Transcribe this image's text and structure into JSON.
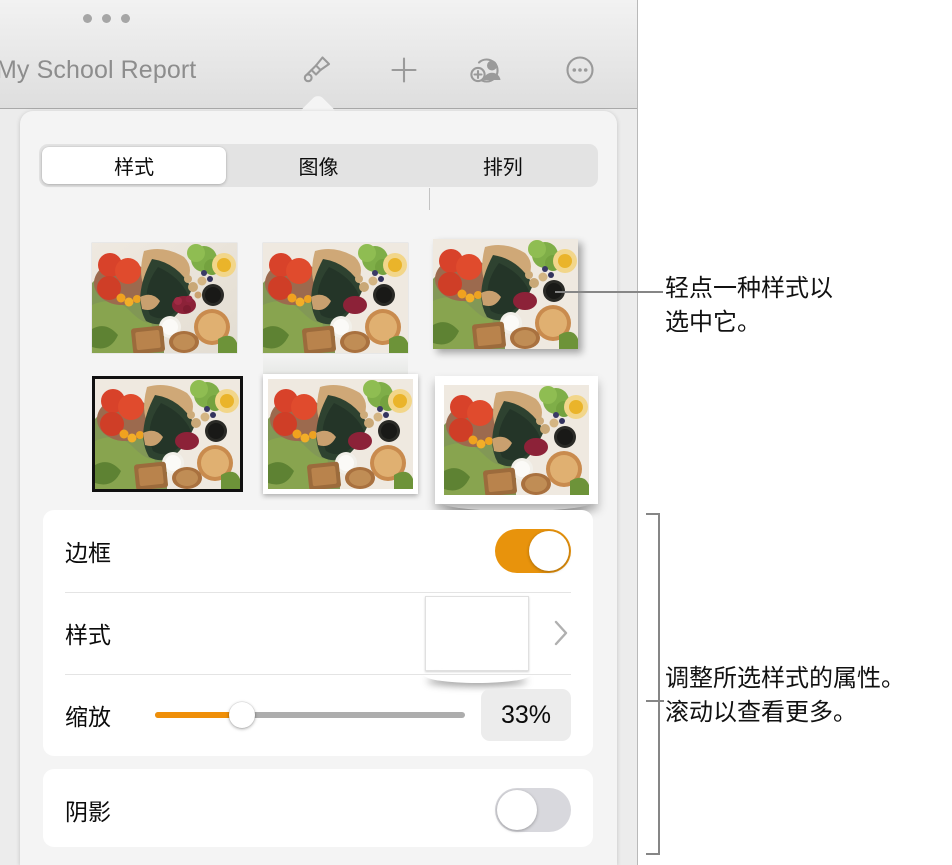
{
  "window": {
    "title": "My School Report",
    "dots_icon": "window-dots-icon"
  },
  "toolbar": {
    "buttons": [
      {
        "name": "format-brush",
        "icon": "paintbrush-icon",
        "label": ""
      },
      {
        "name": "insert",
        "icon": "plus-icon",
        "label": ""
      },
      {
        "name": "collaborate",
        "icon": "add-person-icon",
        "label": ""
      },
      {
        "name": "more",
        "icon": "ellipsis-circle-icon",
        "label": ""
      }
    ]
  },
  "panel": {
    "tabs": [
      {
        "label": "样式",
        "selected": true
      },
      {
        "label": "图像",
        "selected": false
      },
      {
        "label": "排列",
        "selected": false
      }
    ],
    "thumbnails": [
      {
        "name": "style-thumb-1",
        "style": "plain",
        "selected": false
      },
      {
        "name": "style-thumb-2",
        "style": "reflection",
        "selected": false
      },
      {
        "name": "style-thumb-3",
        "style": "drop-shadow",
        "selected": false
      },
      {
        "name": "style-thumb-4",
        "style": "black-frame",
        "selected": false
      },
      {
        "name": "style-thumb-5",
        "style": "white-border",
        "selected": false
      },
      {
        "name": "style-thumb-6",
        "style": "polaroid-frame",
        "selected": false
      }
    ],
    "controls": {
      "border": {
        "label": "边框",
        "toggle_on": true,
        "accent": "#e8930c"
      },
      "style": {
        "label": "样式",
        "swatch_color": "#a8d3ec",
        "chevron": "chevron-right-icon"
      },
      "scale": {
        "label": "缩放",
        "value": "33%",
        "percent": 28,
        "accent": "#ef8f08"
      },
      "shadow": {
        "label": "阴影",
        "toggle_on": false
      }
    }
  },
  "callouts": [
    {
      "name": "callout-style-tap",
      "text": "轻点一种样式以\n选中它。"
    },
    {
      "name": "callout-adjust-properties",
      "text": "调整所选样式的属性。\n滚动以查看更多。"
    }
  ]
}
